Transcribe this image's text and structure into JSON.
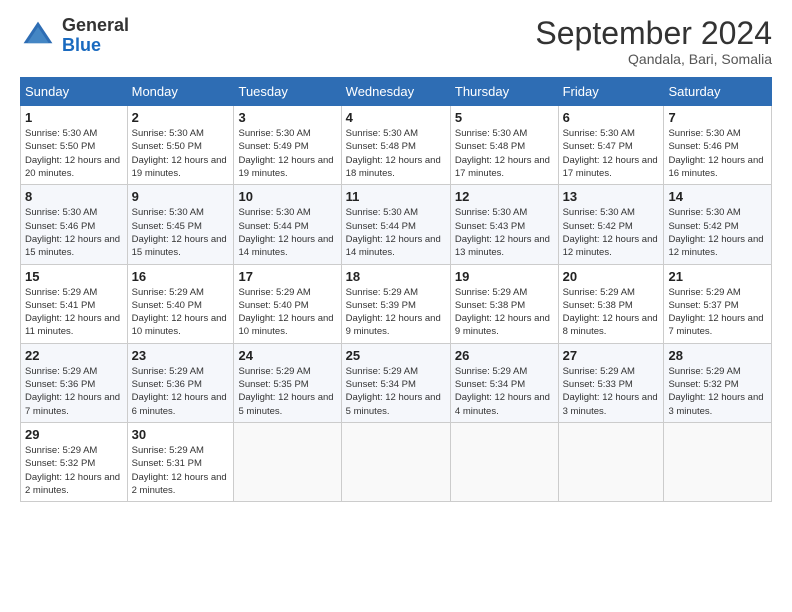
{
  "header": {
    "logo_general": "General",
    "logo_blue": "Blue",
    "month_title": "September 2024",
    "subtitle": "Qandala, Bari, Somalia"
  },
  "weekdays": [
    "Sunday",
    "Monday",
    "Tuesday",
    "Wednesday",
    "Thursday",
    "Friday",
    "Saturday"
  ],
  "weeks": [
    [
      {
        "day": "1",
        "rise": "5:30 AM",
        "set": "5:50 PM",
        "daylight": "12 hours and 20 minutes."
      },
      {
        "day": "2",
        "rise": "5:30 AM",
        "set": "5:50 PM",
        "daylight": "12 hours and 19 minutes."
      },
      {
        "day": "3",
        "rise": "5:30 AM",
        "set": "5:49 PM",
        "daylight": "12 hours and 19 minutes."
      },
      {
        "day": "4",
        "rise": "5:30 AM",
        "set": "5:48 PM",
        "daylight": "12 hours and 18 minutes."
      },
      {
        "day": "5",
        "rise": "5:30 AM",
        "set": "5:48 PM",
        "daylight": "12 hours and 17 minutes."
      },
      {
        "day": "6",
        "rise": "5:30 AM",
        "set": "5:47 PM",
        "daylight": "12 hours and 17 minutes."
      },
      {
        "day": "7",
        "rise": "5:30 AM",
        "set": "5:46 PM",
        "daylight": "12 hours and 16 minutes."
      }
    ],
    [
      {
        "day": "8",
        "rise": "5:30 AM",
        "set": "5:46 PM",
        "daylight": "12 hours and 15 minutes."
      },
      {
        "day": "9",
        "rise": "5:30 AM",
        "set": "5:45 PM",
        "daylight": "12 hours and 15 minutes."
      },
      {
        "day": "10",
        "rise": "5:30 AM",
        "set": "5:44 PM",
        "daylight": "12 hours and 14 minutes."
      },
      {
        "day": "11",
        "rise": "5:30 AM",
        "set": "5:44 PM",
        "daylight": "12 hours and 14 minutes."
      },
      {
        "day": "12",
        "rise": "5:30 AM",
        "set": "5:43 PM",
        "daylight": "12 hours and 13 minutes."
      },
      {
        "day": "13",
        "rise": "5:30 AM",
        "set": "5:42 PM",
        "daylight": "12 hours and 12 minutes."
      },
      {
        "day": "14",
        "rise": "5:30 AM",
        "set": "5:42 PM",
        "daylight": "12 hours and 12 minutes."
      }
    ],
    [
      {
        "day": "15",
        "rise": "5:29 AM",
        "set": "5:41 PM",
        "daylight": "12 hours and 11 minutes."
      },
      {
        "day": "16",
        "rise": "5:29 AM",
        "set": "5:40 PM",
        "daylight": "12 hours and 10 minutes."
      },
      {
        "day": "17",
        "rise": "5:29 AM",
        "set": "5:40 PM",
        "daylight": "12 hours and 10 minutes."
      },
      {
        "day": "18",
        "rise": "5:29 AM",
        "set": "5:39 PM",
        "daylight": "12 hours and 9 minutes."
      },
      {
        "day": "19",
        "rise": "5:29 AM",
        "set": "5:38 PM",
        "daylight": "12 hours and 9 minutes."
      },
      {
        "day": "20",
        "rise": "5:29 AM",
        "set": "5:38 PM",
        "daylight": "12 hours and 8 minutes."
      },
      {
        "day": "21",
        "rise": "5:29 AM",
        "set": "5:37 PM",
        "daylight": "12 hours and 7 minutes."
      }
    ],
    [
      {
        "day": "22",
        "rise": "5:29 AM",
        "set": "5:36 PM",
        "daylight": "12 hours and 7 minutes."
      },
      {
        "day": "23",
        "rise": "5:29 AM",
        "set": "5:36 PM",
        "daylight": "12 hours and 6 minutes."
      },
      {
        "day": "24",
        "rise": "5:29 AM",
        "set": "5:35 PM",
        "daylight": "12 hours and 5 minutes."
      },
      {
        "day": "25",
        "rise": "5:29 AM",
        "set": "5:34 PM",
        "daylight": "12 hours and 5 minutes."
      },
      {
        "day": "26",
        "rise": "5:29 AM",
        "set": "5:34 PM",
        "daylight": "12 hours and 4 minutes."
      },
      {
        "day": "27",
        "rise": "5:29 AM",
        "set": "5:33 PM",
        "daylight": "12 hours and 3 minutes."
      },
      {
        "day": "28",
        "rise": "5:29 AM",
        "set": "5:32 PM",
        "daylight": "12 hours and 3 minutes."
      }
    ],
    [
      {
        "day": "29",
        "rise": "5:29 AM",
        "set": "5:32 PM",
        "daylight": "12 hours and 2 minutes."
      },
      {
        "day": "30",
        "rise": "5:29 AM",
        "set": "5:31 PM",
        "daylight": "12 hours and 2 minutes."
      },
      null,
      null,
      null,
      null,
      null
    ]
  ]
}
